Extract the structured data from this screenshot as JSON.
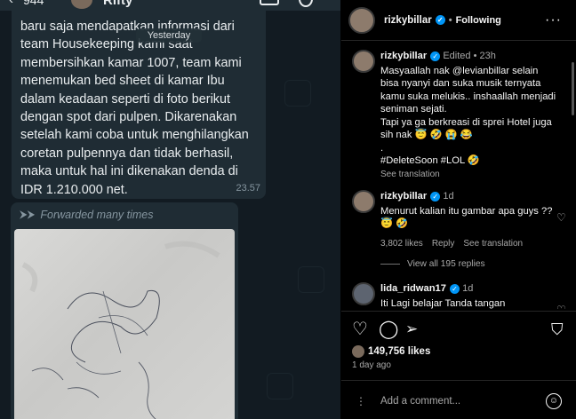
{
  "chat": {
    "header": {
      "back": "‹",
      "count": "944",
      "name": "Rifty"
    },
    "date_separator": "Yesterday",
    "message": {
      "text": "baru saja mendapatkan informasi dari\nteam Housekeeping kami saat\nmembersihkan kamar 1007, team kami\nmenemukan bed sheet di kamar Ibu\ndalam keadaan seperti di foto berikut\ndengan spot dari pulpen. Dikarenakan\nsetelah kami coba untuk menghilangkan\ncoretan pulpennya dan tidak berhasil,\nmaka untuk hal ini dikenakan denda di\nIDR 1.210.000 net.",
      "time": "23.57"
    },
    "forwarded": {
      "label": "Forwarded many times"
    }
  },
  "instagram": {
    "header": {
      "username": "rizkybillar",
      "status": "Following",
      "more": "···"
    },
    "caption": {
      "username": "rizkybillar",
      "meta": "Edited • 23h",
      "text": "Masyaallah nak @levianbillar selain bisa nyanyi dan suka musik ternyata kamu suka melukis.. inshaallah menjadi seniman sejati.\nTapi ya ga berkreasi di sprei Hotel juga sih nak 😇 🤣 😭 😂\n.\n#DeleteSoon #LOL 🤣",
      "see_translation": "See translation"
    },
    "comments": [
      {
        "username": "rizkybillar",
        "meta": "1d",
        "text": "Menurut kalian itu gambar apa guys ?? 😇 🤣",
        "likes": "3,802 likes",
        "reply": "Reply",
        "see_translation": "See translation"
      },
      {
        "username": "lida_ridwan17",
        "meta": "1d",
        "text": "Iti Lagi belajar Tanda tangan"
      }
    ],
    "view_replies": "View all 195 replies",
    "likes_count": "149,756 likes",
    "time_ago": "1 day ago",
    "add_comment_placeholder": "Add a comment...",
    "icons": [
      "heart-icon",
      "comment-icon",
      "share-icon",
      "bookmark-icon",
      "emoji-icon"
    ]
  }
}
